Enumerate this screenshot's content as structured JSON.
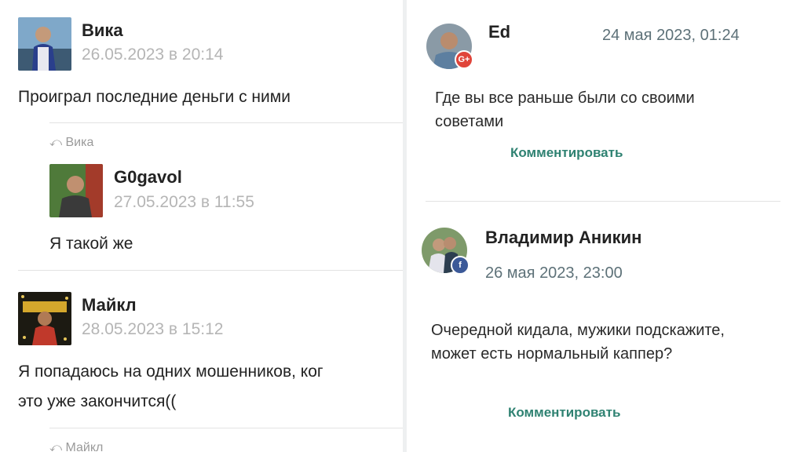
{
  "left": {
    "posts": [
      {
        "name": "Вика",
        "date": "26.05.2023 в 20:14",
        "text": "Проиграл последние деньги с ними"
      },
      {
        "reply_to": "Вика",
        "name": "G0gavol",
        "date": "27.05.2023 в 11:55",
        "text": "Я такой же"
      },
      {
        "name": "Майкл",
        "date": "28.05.2023 в 15:12",
        "text_line1": "Я попадаюсь на одних мошенников, ког",
        "text_line2": "это уже закончится(("
      },
      {
        "reply_to": "Майкл"
      }
    ]
  },
  "right_top": {
    "name": "Ed",
    "date": "24 мая 2023, 01:24",
    "text": "Где вы все раньше были со своими советами",
    "comment_label": "Комментировать",
    "badge": "G+"
  },
  "right_bottom": {
    "name": "Владимир Аникин",
    "date": "26 мая 2023, 23:00",
    "text": "Очередной кидала, мужики подскажите, может есть нормальный каппер?",
    "comment_label": "Комментировать",
    "badge": "f"
  },
  "colors": {
    "accent_green": "#2f8272",
    "date_grey": "#b5b5b5",
    "google_red": "#e0443a",
    "facebook_blue": "#3b5998"
  },
  "icons": [
    "reply-arrow-icon",
    "google-plus-badge-icon",
    "facebook-badge-icon"
  ]
}
